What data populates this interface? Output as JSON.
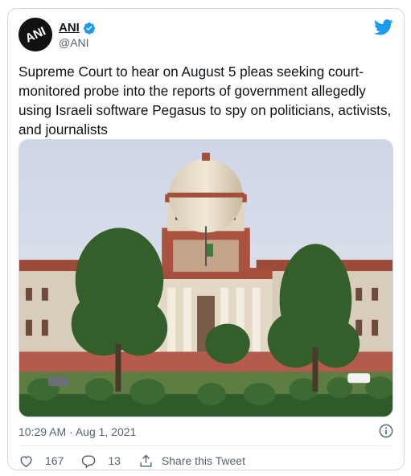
{
  "tweet": {
    "author": {
      "display_name": "ANI",
      "handle": "@ANI",
      "avatar_text": "ANI",
      "verified": true
    },
    "text": "Supreme Court to hear on August 5 pleas seeking court-monitored probe into the reports of government allegedly using Israeli software Pegasus to spy on politicians, activists, and journalists",
    "timestamp": "10:29 AM · Aug 1, 2021",
    "likes": "167",
    "replies": "13",
    "share_label": "Share this Tweet"
  },
  "colors": {
    "twitter_blue": "#1d9bf0",
    "muted_text": "#536471",
    "border": "#cfd9de"
  },
  "icons": [
    "twitter-bird-icon",
    "verified-badge-icon",
    "info-icon",
    "heart-icon",
    "reply-icon",
    "share-icon"
  ]
}
